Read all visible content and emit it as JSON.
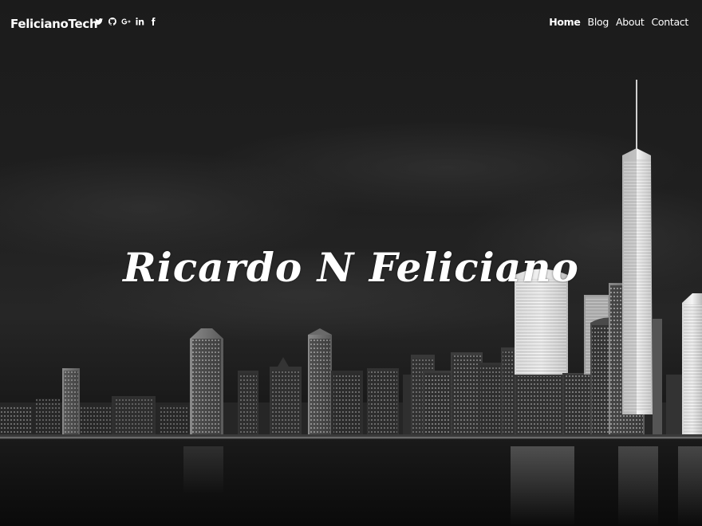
{
  "navbar": {
    "brand": "FelicianoTech",
    "social_icons": [
      {
        "name": "twitter-icon"
      },
      {
        "name": "github-icon"
      },
      {
        "name": "google-plus-icon"
      },
      {
        "name": "linkedin-icon"
      },
      {
        "name": "facebook-icon"
      }
    ],
    "links": [
      {
        "label": "Home",
        "active": true
      },
      {
        "label": "Blog",
        "active": false
      },
      {
        "label": "About",
        "active": false
      },
      {
        "label": "Contact",
        "active": false
      }
    ]
  },
  "hero": {
    "title": "Ricardo N Feliciano",
    "background": "night-city-skyline-photo"
  },
  "colors": {
    "text": "#ffffff",
    "background": "#1c1c1c"
  }
}
